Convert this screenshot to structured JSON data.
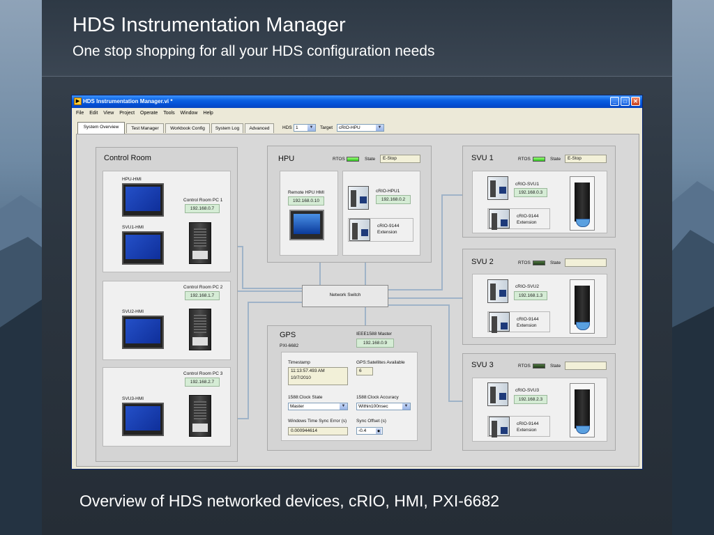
{
  "slide": {
    "title": "HDS Instrumentation Manager",
    "subtitle": "One stop shopping for all your HDS configuration needs",
    "caption": "Overview of HDS networked devices, cRIO, HMI, PXI-6682"
  },
  "window": {
    "title": "HDS Instrumentation Manager.vi *",
    "menu": [
      "File",
      "Edit",
      "View",
      "Project",
      "Operate",
      "Tools",
      "Window",
      "Help"
    ],
    "tabs": [
      "System Overview",
      "Test Manager",
      "Workbook Config",
      "System Log",
      "Advanced"
    ],
    "active_tab": "System Overview",
    "hds_label": "HDS",
    "hds_value": "1",
    "target_label": "Target",
    "target_value": "cRIO-HPU"
  },
  "control_room": {
    "title": "Control Room",
    "groups": [
      {
        "hmi_a": "HPU-HMI",
        "hmi_b": "SVU1-HMI",
        "pc": "Control Room PC 1",
        "ip": "192.168.0.7"
      },
      {
        "hmi": "SVU2-HMI",
        "pc": "Control Room PC 2",
        "ip": "192.168.1.7"
      },
      {
        "hmi": "SVU3-HMI",
        "pc": "Control Room PC 3",
        "ip": "192.168.2.7"
      }
    ]
  },
  "hpu": {
    "title": "HPU",
    "rtos_label": "RTOS",
    "rtos_on": true,
    "state_label": "State",
    "state_value": "E-Stop",
    "remote_hmi_label": "Remote HPU HMI",
    "remote_hmi_ip": "192.168.0.10",
    "crio_label": "cRIO-HPU1",
    "crio_ip": "192.168.0.2",
    "ext_label_1": "cRIO-9144",
    "ext_label_2": "Extension"
  },
  "network_switch": "Network Switch",
  "gps": {
    "title": "GPS",
    "device": "PXI-6682",
    "ieee_label": "IEEE1588 Master",
    "ieee_ip": "192.168.0.9",
    "timestamp_label": "Timestamp",
    "timestamp_line1": "11:13:57.493 AM",
    "timestamp_line2": "10/7/2010",
    "satellites_label": "GPS:Satellites Available",
    "satellites_value": "6",
    "clock_state_label": "1588:Clock State",
    "clock_state_value": "Master",
    "clock_accuracy_label": "1588:Clock Accuracy",
    "clock_accuracy_value": "Within100nsec",
    "sync_error_label": "Windows Time Sync Error (s)",
    "sync_error_value": "0.000944614",
    "sync_offset_label": "Sync Offset (s)",
    "sync_offset_value": "-0.4"
  },
  "svus": [
    {
      "title": "SVU 1",
      "rtos_label": "RTOS",
      "rtos_on": true,
      "state_label": "State",
      "state_value": "E-Stop",
      "crio": "cRIO-SVU1",
      "ip": "192.168.0.3",
      "ext1": "cRIO-9144",
      "ext2": "Extension"
    },
    {
      "title": "SVU 2",
      "rtos_label": "RTOS",
      "rtos_on": false,
      "state_label": "State",
      "state_value": "",
      "crio": "cRIO-SVU2",
      "ip": "192.168.1.3",
      "ext1": "cRIO-9144",
      "ext2": "Extension"
    },
    {
      "title": "SVU 3",
      "rtos_label": "RTOS",
      "rtos_on": false,
      "state_label": "State",
      "state_value": "",
      "crio": "cRIO-SVU3",
      "ip": "192.168.2.3",
      "ext1": "cRIO-9144",
      "ext2": "Extension"
    }
  ]
}
